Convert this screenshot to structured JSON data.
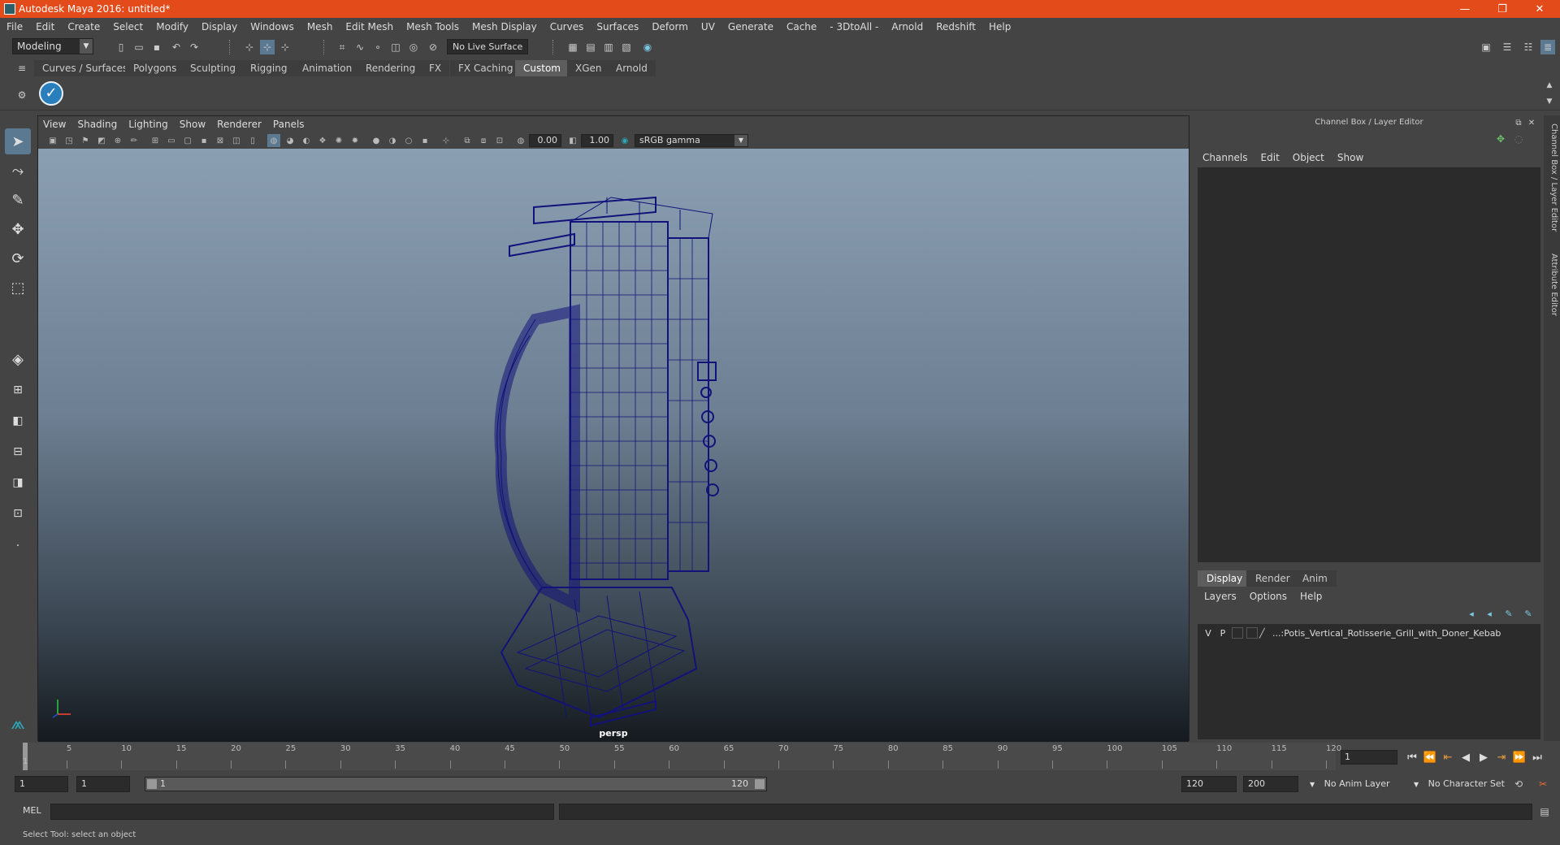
{
  "window": {
    "title": "Autodesk Maya 2016: untitled*",
    "minimize": "—",
    "restore": "❐",
    "close": "✕"
  },
  "menubar": [
    "File",
    "Edit",
    "Create",
    "Select",
    "Modify",
    "Display",
    "Windows",
    "Mesh",
    "Edit Mesh",
    "Mesh Tools",
    "Mesh Display",
    "Curves",
    "Surfaces",
    "Deform",
    "UV",
    "Generate",
    "Cache",
    "- 3DtoAll -",
    "Arnold",
    "Redshift",
    "Help"
  ],
  "statusline": {
    "mode": "Modeling",
    "live_surface": "No Live Surface"
  },
  "shelf": {
    "tabs": [
      "Curves / Surfaces",
      "Polygons",
      "Sculpting",
      "Rigging",
      "Animation",
      "Rendering",
      "FX",
      "FX Caching",
      "Custom",
      "XGen",
      "Arnold"
    ],
    "active_tab": "Custom"
  },
  "viewport": {
    "menu": [
      "View",
      "Shading",
      "Lighting",
      "Show",
      "Renderer",
      "Panels"
    ],
    "exposure": "0.00",
    "gamma": "1.00",
    "colorspace": "sRGB gamma",
    "camera": "persp"
  },
  "channel_box": {
    "title": "Channel Box / Layer Editor",
    "menu": [
      "Channels",
      "Edit",
      "Object",
      "Show"
    ]
  },
  "layer_editor": {
    "tabs": [
      "Display",
      "Render",
      "Anim"
    ],
    "active_tab": "Display",
    "menu": [
      "Layers",
      "Options",
      "Help"
    ],
    "layers": [
      {
        "v": "V",
        "p": "P",
        "name": "...:Potis_Vertical_Rotisserie_Grill_with_Doner_Kebab"
      }
    ]
  },
  "side_tabs": [
    "Channel Box / Layer Editor",
    "Attribute Editor"
  ],
  "timeline": {
    "ticks": [
      "1",
      "5",
      "10",
      "15",
      "20",
      "25",
      "30",
      "35",
      "40",
      "45",
      "50",
      "55",
      "60",
      "65",
      "70",
      "75",
      "80",
      "85",
      "90",
      "95",
      "100",
      "105",
      "110",
      "115",
      "120"
    ],
    "current_frame": "1"
  },
  "range": {
    "start": "1",
    "anim_start": "1",
    "slider_start": "1",
    "slider_end": "120",
    "end": "120",
    "anim_end": "200",
    "anim_layer": "No Anim Layer",
    "char_set": "No Character Set"
  },
  "cmdline": {
    "label": "MEL"
  },
  "helpline": "Select Tool: select an object",
  "colors": {
    "titlebar": "#e34b1b",
    "wireframe": "#12127a",
    "active_tool": "#5c7992"
  }
}
